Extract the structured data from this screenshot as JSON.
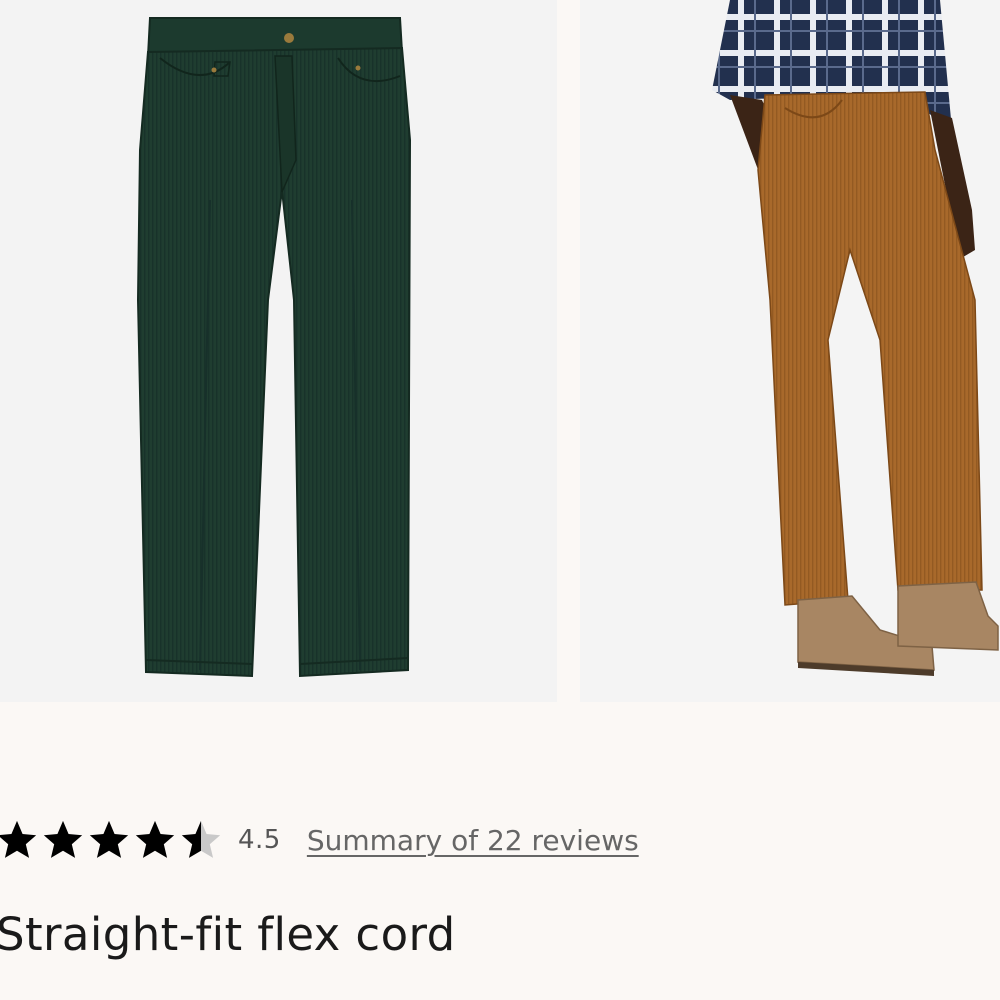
{
  "product": {
    "title": "Straight-fit flex cord",
    "rating_value": "4.5",
    "rating_stars": 4.5,
    "rating_max": 5,
    "reviews_link": "Summary of 22 reviews"
  },
  "gallery": {
    "images": [
      {
        "name": "green-corduroy-flat",
        "color": "#1f3d30"
      },
      {
        "name": "tan-corduroy-model",
        "color": "#a8692b"
      }
    ]
  },
  "icons": {
    "star": "star-icon",
    "half_star": "half-star-icon"
  }
}
